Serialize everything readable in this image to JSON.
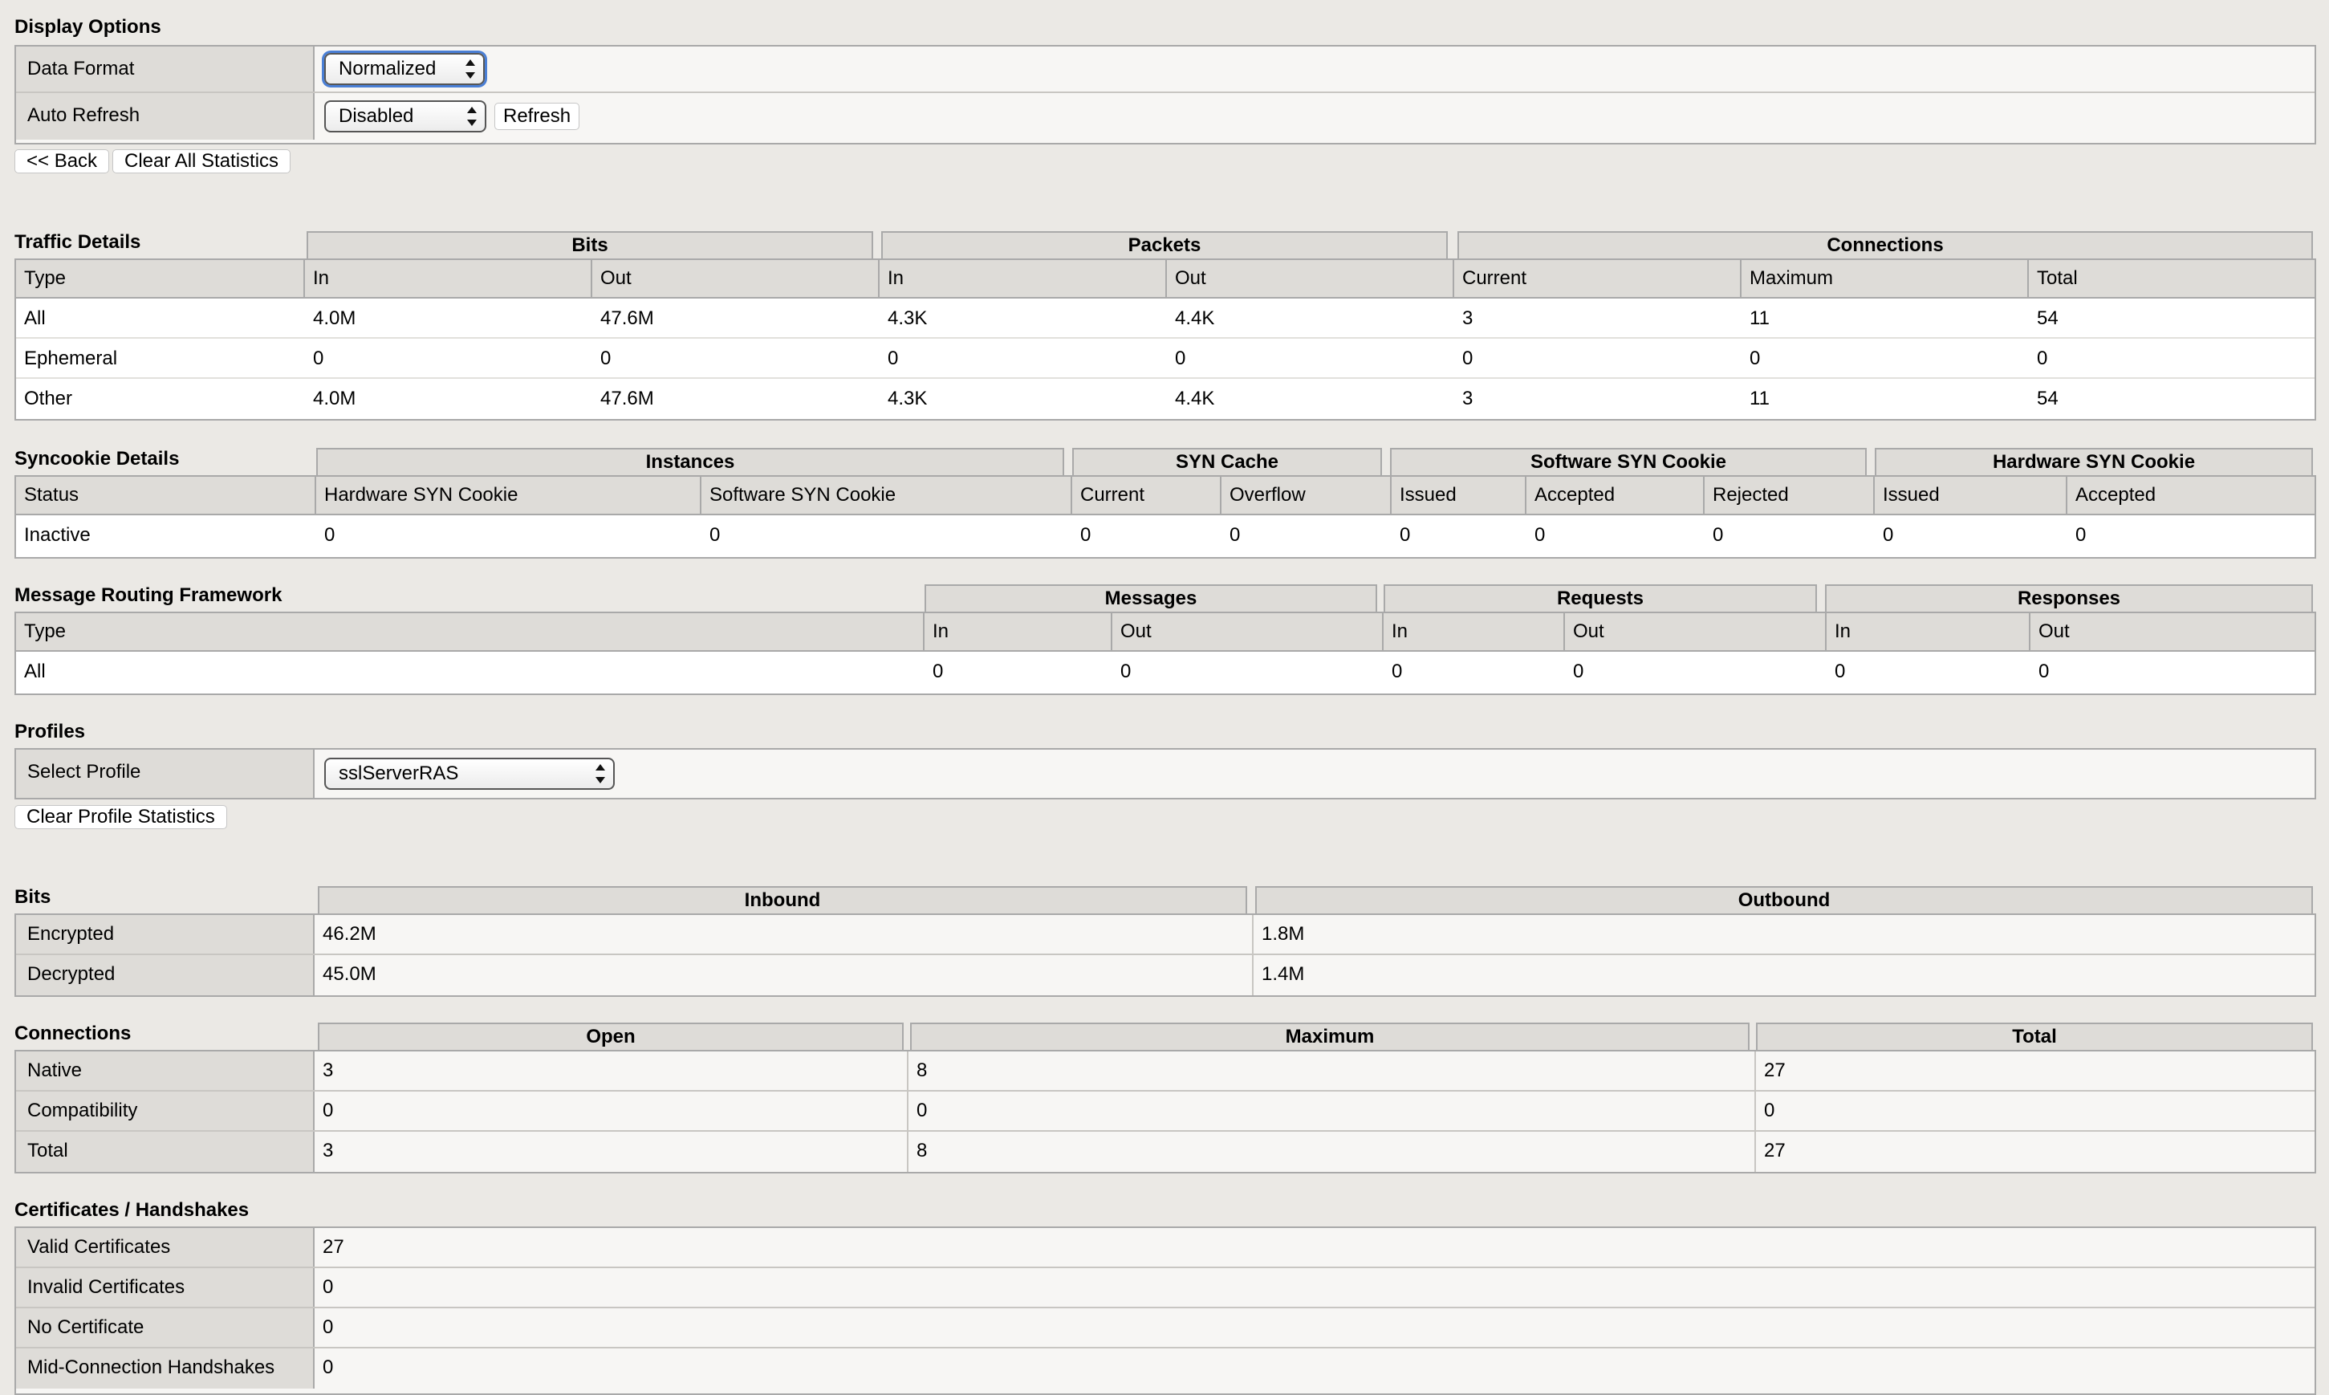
{
  "display_options": {
    "title": "Display Options",
    "data_format_label": "Data Format",
    "data_format_value": "Normalized",
    "auto_refresh_label": "Auto Refresh",
    "auto_refresh_value": "Disabled",
    "refresh_button": "Refresh",
    "back_button": "<< Back",
    "clear_all_button": "Clear All Statistics"
  },
  "traffic": {
    "title": "Traffic Details",
    "groups": [
      "Bits",
      "Packets",
      "Connections"
    ],
    "columns": [
      "Type",
      "In",
      "Out",
      "In",
      "Out",
      "Current",
      "Maximum",
      "Total"
    ],
    "rows": [
      [
        "All",
        "4.0M",
        "47.6M",
        "4.3K",
        "4.4K",
        "3",
        "11",
        "54"
      ],
      [
        "Ephemeral",
        "0",
        "0",
        "0",
        "0",
        "0",
        "0",
        "0"
      ],
      [
        "Other",
        "4.0M",
        "47.6M",
        "4.3K",
        "4.4K",
        "3",
        "11",
        "54"
      ]
    ]
  },
  "syncookie": {
    "title": "Syncookie Details",
    "groups": [
      "Instances",
      "SYN Cache",
      "Software SYN Cookie",
      "Hardware SYN Cookie"
    ],
    "columns": [
      "Status",
      "Hardware SYN Cookie",
      "Software SYN Cookie",
      "Current",
      "Overflow",
      "Issued",
      "Accepted",
      "Rejected",
      "Issued",
      "Accepted"
    ],
    "rows": [
      [
        "Inactive",
        "0",
        "0",
        "0",
        "0",
        "0",
        "0",
        "0",
        "0",
        "0"
      ]
    ]
  },
  "mrf": {
    "title": "Message Routing Framework",
    "groups": [
      "Messages",
      "Requests",
      "Responses"
    ],
    "columns": [
      "Type",
      "In",
      "Out",
      "In",
      "Out",
      "In",
      "Out"
    ],
    "rows": [
      [
        "All",
        "0",
        "0",
        "0",
        "0",
        "0",
        "0"
      ]
    ]
  },
  "profiles": {
    "title": "Profiles",
    "select_label": "Select Profile",
    "select_value": "sslServerRAS",
    "clear_button": "Clear Profile Statistics"
  },
  "bits": {
    "title": "Bits",
    "groups": [
      "Inbound",
      "Outbound"
    ],
    "rows": [
      [
        "Encrypted",
        "46.2M",
        "1.8M"
      ],
      [
        "Decrypted",
        "45.0M",
        "1.4M"
      ]
    ]
  },
  "connections": {
    "title": "Connections",
    "groups": [
      "Open",
      "Maximum",
      "Total"
    ],
    "rows": [
      [
        "Native",
        "3",
        "8",
        "27"
      ],
      [
        "Compatibility",
        "0",
        "0",
        "0"
      ],
      [
        "Total",
        "3",
        "8",
        "27"
      ]
    ]
  },
  "certs": {
    "title": "Certificates / Handshakes",
    "rows": [
      [
        "Valid Certificates",
        "27"
      ],
      [
        "Invalid Certificates",
        "0"
      ],
      [
        "No Certificate",
        "0"
      ],
      [
        "Mid-Connection Handshakes",
        "0"
      ]
    ]
  }
}
